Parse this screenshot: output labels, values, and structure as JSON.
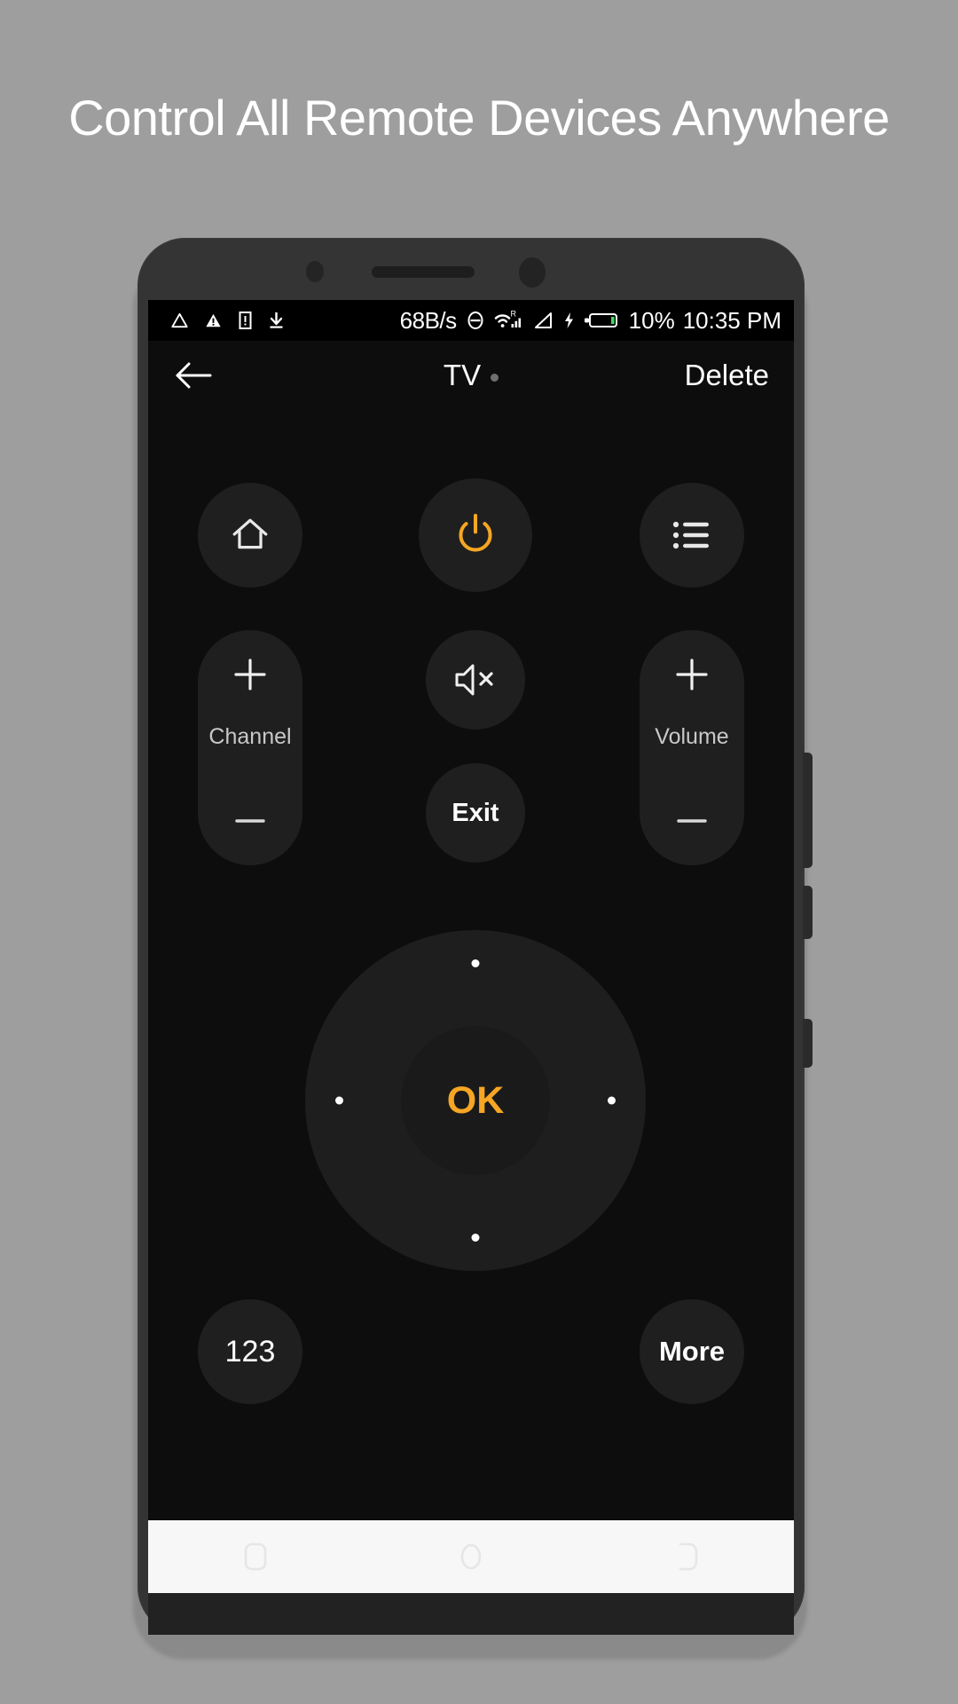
{
  "headline": "Control All Remote Devices Anywhere",
  "colors": {
    "page_background": "#9e9e9e",
    "accent": "#f5a623",
    "screen_background": "#0d0d0d",
    "button_background": "#1f1f1f",
    "text_primary": "#ffffff",
    "battery_fill": "#3ddc64"
  },
  "statusbar": {
    "left_icons": [
      "developer-triangle-icon",
      "warning-triangle-icon",
      "sim-alert-icon",
      "download-icon"
    ],
    "network_speed": "68B/s",
    "dnd_icon": "do-not-disturb-icon",
    "wifi_icon": "wifi-roaming-icon",
    "wifi_roaming_label": "R",
    "signal_icon": "signal-bars-icon",
    "signal2_icon": "signal-triangle-icon",
    "charging_icon": "charging-bolt-icon",
    "battery_icon": "battery-icon",
    "battery_percent": "10%",
    "time": "10:35 PM"
  },
  "appbar": {
    "back_icon": "back-arrow-icon",
    "title": "TV",
    "status_dot": "connection-status-dot",
    "action_label": "Delete"
  },
  "remote": {
    "row1": [
      {
        "name": "home-button",
        "icon": "home-icon",
        "label": ""
      },
      {
        "name": "power-button",
        "icon": "power-icon",
        "label": ""
      },
      {
        "name": "menu-list-button",
        "icon": "list-icon",
        "label": ""
      }
    ],
    "channel": {
      "label": "Channel",
      "plus_icon": "plus-icon",
      "minus_icon": "minus-icon"
    },
    "volume": {
      "label": "Volume",
      "plus_icon": "plus-icon",
      "minus_icon": "minus-icon"
    },
    "mute": {
      "icon": "mute-speaker-icon"
    },
    "exit": {
      "label": "Exit"
    },
    "dpad": {
      "ok_label": "OK",
      "up_icon": "dpad-up-dot",
      "down_icon": "dpad-down-dot",
      "left_icon": "dpad-left-dot",
      "right_icon": "dpad-right-dot"
    },
    "row3": [
      {
        "name": "numpad-button",
        "label": "123"
      },
      {
        "name": "more-button",
        "label": "More"
      }
    ]
  },
  "navbar": {
    "recents_icon": "recents-square-icon",
    "home_icon": "home-circle-icon",
    "back_icon": "back-shape-icon"
  },
  "hardware": {
    "front_camera": "front-camera",
    "earpiece_speaker": "earpiece-speaker",
    "proximity_sensor": "proximity-sensor",
    "volume_up_button": "volume-up-hw-button",
    "volume_down_button": "volume-down-hw-button",
    "power_hw_button": "power-hw-button"
  }
}
